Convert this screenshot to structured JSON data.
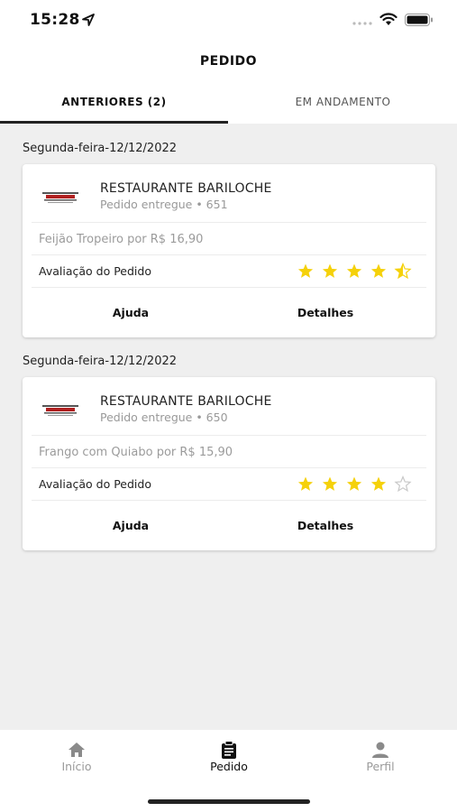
{
  "status_bar": {
    "time": "15:28"
  },
  "header": {
    "title": "PEDIDO"
  },
  "tabs": [
    {
      "label": "ANTERIORES (2)",
      "active": true
    },
    {
      "label": "EM ANDAMENTO",
      "active": false
    }
  ],
  "orders": [
    {
      "date": "Segunda-feira-12/12/2022",
      "restaurant": "RESTAURANTE BARILOCHE",
      "status": "Pedido entregue • 651",
      "item": "Feijão Tropeiro por R$ 16,90",
      "rating_label": "Avaliação do Pedido",
      "rating": 4.5,
      "rating_max": 5,
      "help_label": "Ajuda",
      "details_label": "Detalhes"
    },
    {
      "date": "Segunda-feira-12/12/2022",
      "restaurant": "RESTAURANTE BARILOCHE",
      "status": "Pedido entregue • 650",
      "item": "Frango com Quiabo por R$ 15,90",
      "rating_label": "Avaliação do Pedido",
      "rating": 4,
      "rating_max": 5,
      "help_label": "Ajuda",
      "details_label": "Detalhes"
    }
  ],
  "bottom_nav": [
    {
      "label": "Início",
      "icon": "home-icon",
      "active": false
    },
    {
      "label": "Pedido",
      "icon": "clipboard-icon",
      "active": true
    },
    {
      "label": "Perfil",
      "icon": "person-icon",
      "active": false
    }
  ],
  "colors": {
    "star": "#f5d10a",
    "star_empty": "#c8c8c8",
    "accent": "#222222"
  }
}
